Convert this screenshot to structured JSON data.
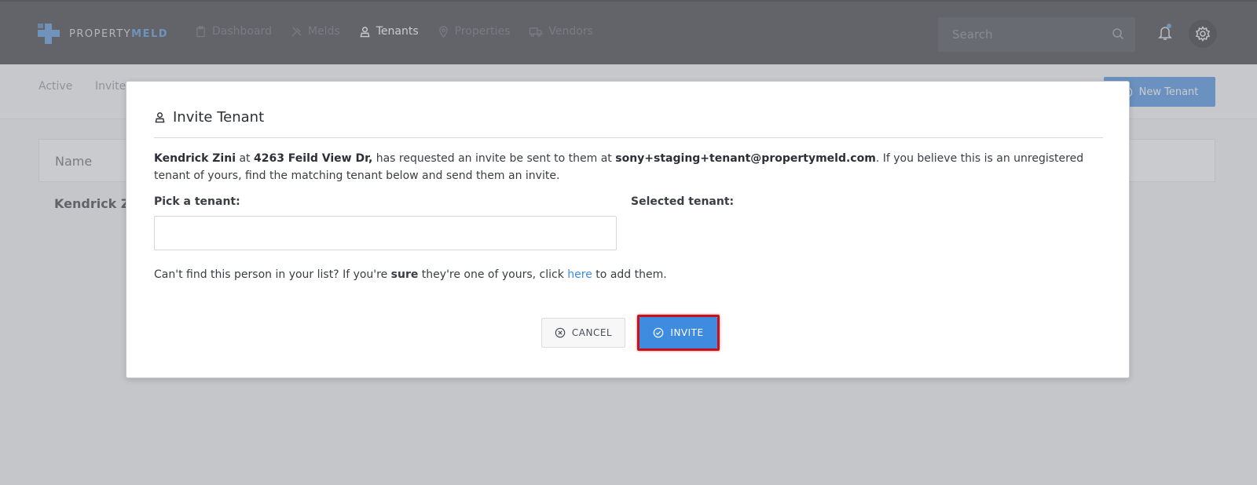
{
  "app": {
    "logo_prefix": "PROPERTY",
    "logo_suffix": "MELD"
  },
  "nav": {
    "items": [
      {
        "label": "Dashboard",
        "icon": "clipboard-icon",
        "active": false
      },
      {
        "label": "Melds",
        "icon": "tools-icon",
        "active": false
      },
      {
        "label": "Tenants",
        "icon": "user-icon",
        "active": true
      },
      {
        "label": "Properties",
        "icon": "map-pin-icon",
        "active": false
      },
      {
        "label": "Vendors",
        "icon": "truck-icon",
        "active": false
      }
    ],
    "search_placeholder": "Search"
  },
  "subbar": {
    "tab_active": "Active",
    "tab_invite": "Invite",
    "new_tenant_label": "New Tenant"
  },
  "table": {
    "name_header": "Name",
    "row_name": "Kendrick Zi"
  },
  "modal": {
    "title": "Invite Tenant",
    "msg_name": "Kendrick Zini",
    "msg_at": " at ",
    "msg_address": "4263 Feild View Dr,",
    "msg_mid": " has requested an invite be sent to them at ",
    "msg_email": "sony+staging+tenant@propertymeld.com",
    "msg_end": ". If you believe this is an unregistered tenant of yours, find the matching tenant below and send them an invite.",
    "pick_label": "Pick a tenant:",
    "pick_value": "",
    "selected_label": "Selected tenant:",
    "cant_find_start": "Can't find this person in your list? If you're ",
    "cant_find_sure": "sure",
    "cant_find_mid": " they're one of yours, click ",
    "cant_find_link": "here",
    "cant_find_end": " to add them.",
    "cancel_label": "CANCEL",
    "invite_label": "INVITE"
  },
  "colors": {
    "accent": "#3f8be0",
    "topbar": "#2e3036",
    "highlight": "#c4131a"
  }
}
